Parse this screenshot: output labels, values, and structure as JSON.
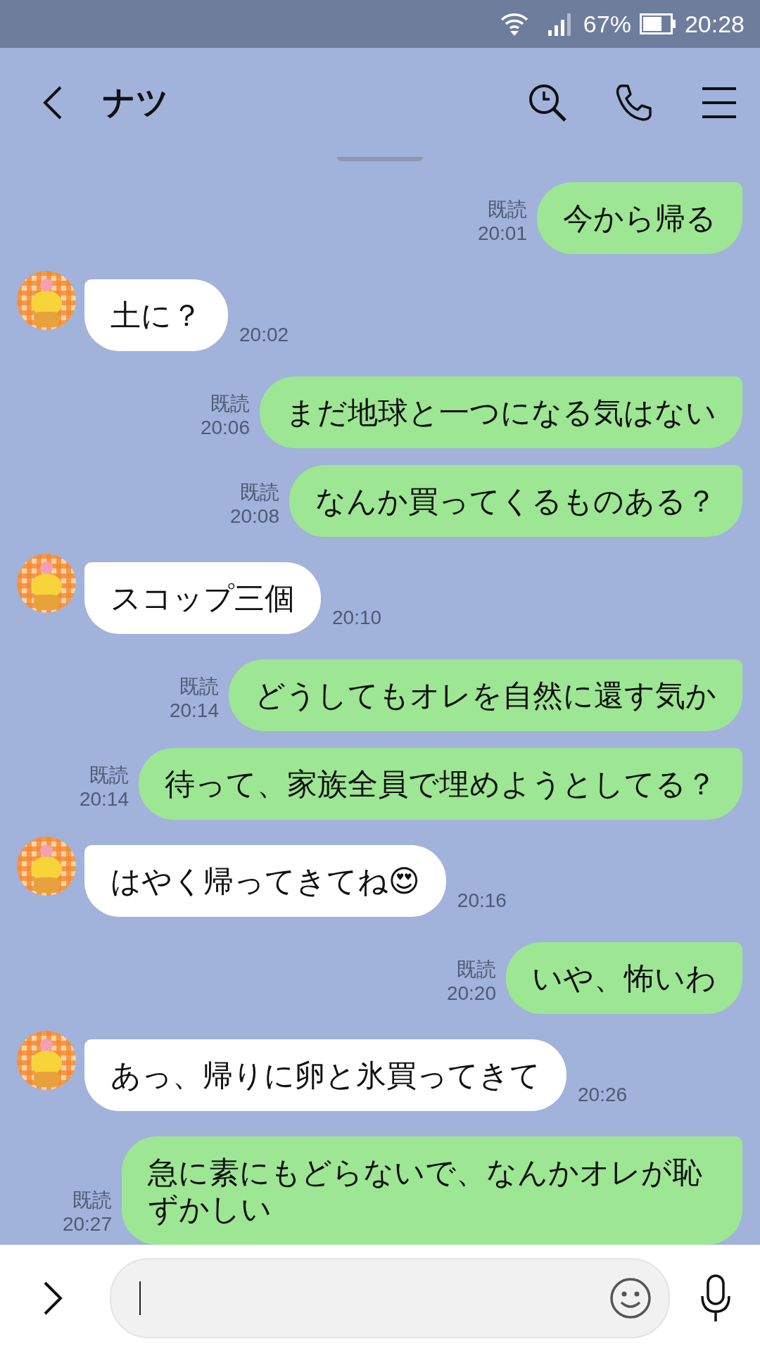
{
  "status_bar": {
    "battery": "67%",
    "time": "20:28"
  },
  "header": {
    "title": "ナツ"
  },
  "messages": [
    {
      "kind": "sent",
      "text": "今から帰る",
      "read": "既読",
      "time": "20:01"
    },
    {
      "kind": "received",
      "text": "土に？",
      "time": "20:02"
    },
    {
      "kind": "sent",
      "text": "まだ地球と一つになる気はない",
      "read": "既読",
      "time": "20:06"
    },
    {
      "kind": "sent",
      "text": "なんか買ってくるものある？",
      "read": "既読",
      "time": "20:08"
    },
    {
      "kind": "received",
      "text": "スコップ三個",
      "time": "20:10"
    },
    {
      "kind": "sent",
      "text": "どうしてもオレを自然に還す気か",
      "read": "既読",
      "time": "20:14"
    },
    {
      "kind": "sent",
      "text": "待って、家族全員で埋めようとしてる？",
      "read": "既読",
      "time": "20:14"
    },
    {
      "kind": "received",
      "text": "はやく帰ってきてね😍",
      "time": "20:16"
    },
    {
      "kind": "sent",
      "text": "いや、怖いわ",
      "read": "既読",
      "time": "20:20"
    },
    {
      "kind": "received",
      "text": "あっ、帰りに卵と氷買ってきて",
      "time": "20:26"
    },
    {
      "kind": "sent",
      "text": "急に素にもどらないで、なんかオレが恥ずかしい",
      "read": "既読",
      "time": "20:27"
    }
  ]
}
